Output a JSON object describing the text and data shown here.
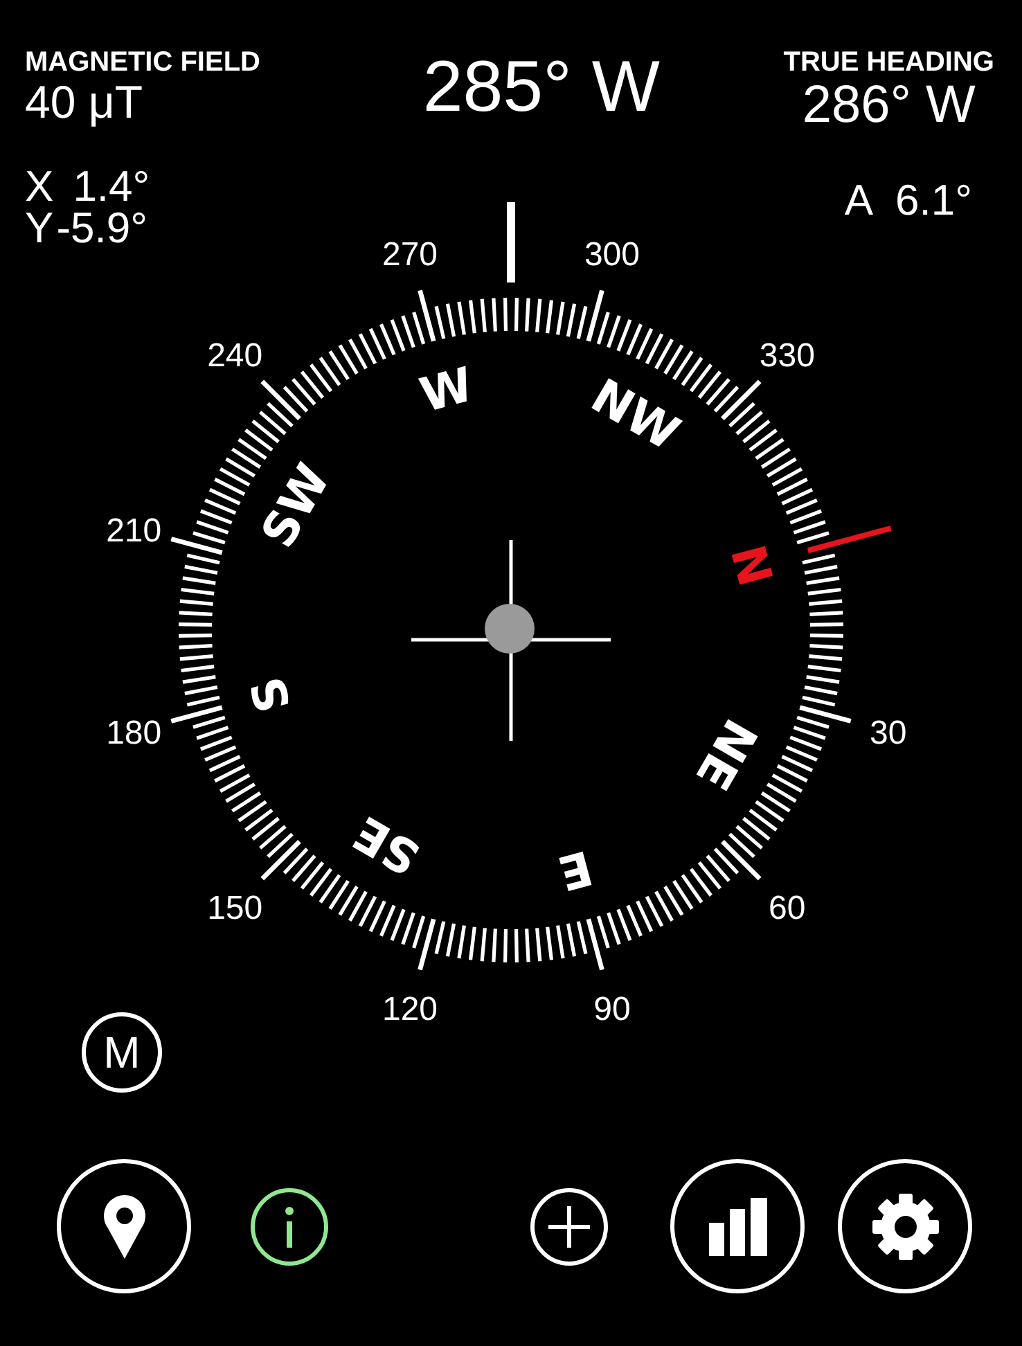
{
  "readouts": {
    "magnetic_field": {
      "label": "MAGNETIC FIELD",
      "value": "40 μT"
    },
    "heading": "285° W",
    "true_heading": {
      "label": "TRUE HEADING",
      "value": "286° W"
    },
    "tilt": [
      {
        "axis": "X",
        "value": "1.4°"
      },
      {
        "axis": "Y",
        "value": "-5.9°"
      }
    ],
    "accuracy": {
      "axis": "A",
      "value": "6.1°"
    }
  },
  "dial": {
    "degree_labels": [
      "30",
      "60",
      "90",
      "120",
      "150",
      "180",
      "210",
      "240",
      "270",
      "300",
      "330"
    ],
    "directions": [
      {
        "label": "N",
        "color": "#e8141c"
      },
      {
        "label": "NE",
        "color": "#ffffff"
      },
      {
        "label": "E",
        "color": "#ffffff"
      },
      {
        "label": "SE",
        "color": "#ffffff"
      },
      {
        "label": "S",
        "color": "#ffffff"
      },
      {
        "label": "SW",
        "color": "#ffffff"
      },
      {
        "label": "W",
        "color": "#ffffff"
      },
      {
        "label": "NW",
        "color": "#ffffff"
      }
    ]
  },
  "mode_button": {
    "label": "M"
  },
  "toolbar": [
    {
      "kind": "pin",
      "color": "#ffffff"
    },
    {
      "kind": "info",
      "color": "#8fe88f"
    },
    {
      "kind": "plus",
      "color": "#ffffff"
    },
    {
      "kind": "chart",
      "color": "#ffffff"
    },
    {
      "kind": "gear",
      "color": "#ffffff"
    }
  ]
}
